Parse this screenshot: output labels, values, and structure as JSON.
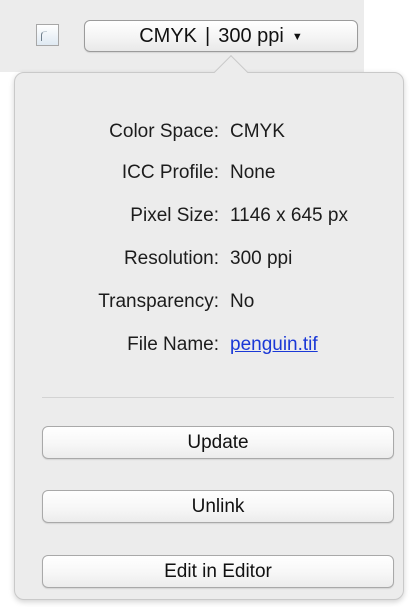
{
  "header": {
    "document_thumbnail_icon": "image-thumbnail-icon",
    "mode_menu": {
      "color_mode": "CMYK",
      "separator": "|",
      "resolution": "300 ppi",
      "dropdown_icon": "chevron-down-icon"
    }
  },
  "info_popover": {
    "rows": [
      {
        "label": "Color Space:",
        "value": "CMYK"
      },
      {
        "label": "ICC Profile:",
        "value": "None"
      },
      {
        "label": "Pixel Size:",
        "value": "1146 x 645 px"
      },
      {
        "label": "Resolution:",
        "value": "300 ppi"
      },
      {
        "label": "Transparency:",
        "value": "No"
      },
      {
        "label": "File Name:",
        "value": "penguin.tif"
      }
    ],
    "buttons": {
      "update": "Update",
      "unlink": "Unlink",
      "edit_in_editor": "Edit in Editor"
    }
  },
  "colors": {
    "panel_background": "#ececec",
    "link_color": "#1a38d6"
  }
}
